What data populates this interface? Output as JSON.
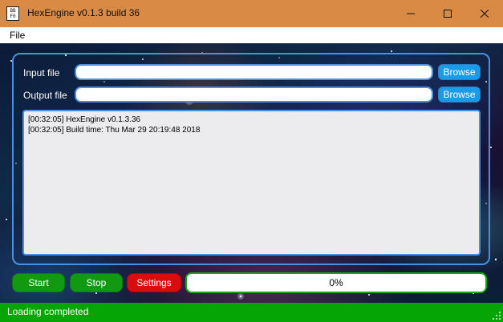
{
  "window": {
    "title": "HexEngine v0.1.3 build 36",
    "icon_text": "BB\nF0"
  },
  "menu": {
    "items": [
      "File"
    ]
  },
  "form": {
    "input_label": "Input file",
    "input_value": "",
    "output_label": "Output file",
    "output_value": "",
    "browse_label": "Browse"
  },
  "log": {
    "lines": [
      "[00:32:05] HexEngine v0.1.3.36",
      "[00:32:05] Build time: Thu Mar 29 20:19:48 2018"
    ]
  },
  "controls": {
    "start_label": "Start",
    "stop_label": "Stop",
    "settings_label": "Settings"
  },
  "progress": {
    "label": "0%",
    "fraction": 0
  },
  "status": {
    "text": "Loading completed"
  },
  "colors": {
    "titlebar": "#d98a45",
    "accent_blue": "#4a90e2",
    "browse": "#1a9be8",
    "start_stop": "#119a11",
    "settings": "#d80d0d",
    "statusbar": "#06a506"
  },
  "icons": [
    "app-icon",
    "minimize-icon",
    "maximize-icon",
    "close-icon",
    "resize-grip-icon"
  ]
}
